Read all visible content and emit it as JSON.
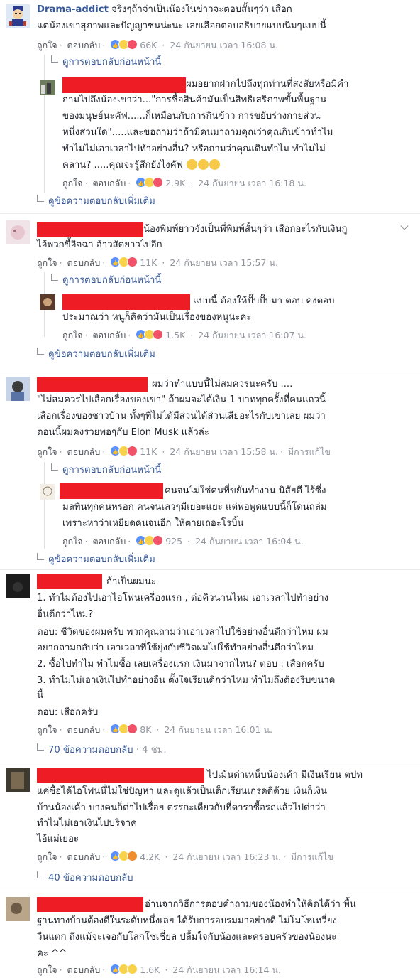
{
  "actions": {
    "like": "ถูกใจ",
    "reply": "ตอบกลับ",
    "edited": "มีการแก้ไข"
  },
  "comments": [
    {
      "author": "Drama-addict",
      "lines": [
        "จริงๆถ้าจ่าเป็นน้องในข่าวจะตอบสั้นๆว่า เสือก",
        "แต่น้องเขาสุภาพและปัญญาชนน่ะนะ เลยเลือกตอบอธิบายแบบนิ่มๆแบบนี้"
      ],
      "reactions": "66K",
      "time": "24 กันยายน เวลา 16:08 น.",
      "prev_replies": "ดูการตอบกลับก่อนหน้านี้"
    },
    {
      "lines": [
        "ผมอยากฝากไปถึงทุกท่านที่สงสัยหรือมีคำ",
        "ถามไปถึงน้องเขาว่า...\"การซื้อสินค้ามันเป็นสิทธิเสรีภาพขั้นพื้นฐาน",
        "ของมนุษย์นะคัฟ......ก็เหมือนกับการกินข้าว การขยับร่างกายส่วน",
        "หนึ่งส่วนใด\".....และขอถามว่าถ้ามีคนมาถามคุณว่าคุณกินข้าวทำไม",
        "ทำไมไม่เอาเวลาไปทำอย่างอื่น? หรือถามว่าคุณเดินทำไม ทำไมไม่",
        "คลาน? .....คุณจะรู้สึกยังไงคัฟ"
      ],
      "reactions": "2.9K",
      "time": "24 กันยายน เวลา 16:18 น.",
      "more_replies": "ดูข้อความตอบกลับเพิ่มเติม"
    },
    {
      "lines": [
        "น้องพิมพ์ยาวจังเป็นพี่พิมพ์สั้นๆว่า เสือกอะไรกับเงินกู",
        "ไอ้พวกขี้อิจฉา อ้าวสัดยาวไปอีก"
      ],
      "reactions": "11K",
      "time": "24 กันยายน เวลา 15:57 น.",
      "prev_replies": "ดูการตอบกลับก่อนหน้านี้"
    },
    {
      "lines": [
        "แบบนี้ ต้องให้ปั๊บปั๊บมา ตอบ คงตอบ",
        "ประมาณว่า หนูก็คิดว่ามันเป็นเรื่องของหนูนะคะ"
      ],
      "reactions": "1.5K",
      "time": "24 กันยายน เวลา 16:07 น.",
      "more_replies": "ดูข้อความตอบกลับเพิ่มเติม"
    },
    {
      "lines": [
        "ผมว่าทำแบบนี้ไม่สมควรนะครับ ....",
        "\"ไม่สมควรไปเสือกเรื่องของเขา\" ถ้าผมจะได้เงิน 1 บาททุกครั้งที่คนแถวนี้",
        "เสือกเรื่องของชาวบ้าน ทั้งๆที่ไม่ได้มีส่วนได้ส่วนเสียอะไรกับเขาเลย ผมว่า",
        "ตอนนี้ผมคงรวยพอๆกับ Elon Musk แล้วล่ะ"
      ],
      "reactions": "11K",
      "time": "24 กันยายน เวลา 15:58 น.",
      "prev_replies": "ดูการตอบกลับก่อนหน้านี้"
    },
    {
      "lines": [
        "คนจนไม่ใช่คนที่ขยันทำงาน นิสัยดี ไร้ซึ่ง",
        "มลทินทุกคนหรอก คนจนเลวๆมีเยอะแยะ แต่พอพูดแบบนี้ก็โดนถล่ม",
        "เพราะหาว่าเหยียดคนจนอีก ให้ตายเถอะโรบิ้น"
      ],
      "reactions": "925",
      "time": "24 กันยายน เวลา 16:04 น.",
      "more_replies": "ดูข้อความตอบกลับเพิ่มเติม"
    },
    {
      "lines": [
        "ถ้าเป็นผมนะ",
        "1. ทำไมต้องไปเอาไอโฟนเครื่องแรก , ต่อคิวนานไหม เอาเวลาไปทำอย่าง",
        "อื่นดีกว่าไหม?",
        "ตอบ: ชีวิตของผมครับ พวกคุณถามว่าเอาเวลาไปใช้อย่างอื่นดีกว่าไหม ผม",
        "อยากถามกลับว่า เอาเวลาที่ใช้ยุ่งกับชีวิตผมไปใช้ทำอย่างอื่นดีกว่าไหม",
        "2. ซื้อไปทำไม ทำไมซื้อ เลยเครื่องแรก เงินมาจากไหน? ตอบ : เสือกครับ",
        "3. ทำไมไม่เอาเงินไปทำอย่างอื่น ตั้งใจเรียนดีกว่าไหม ทำไมถึงต้องรีบขนาด",
        "นี้",
        "ตอบ: เสือกครับ"
      ],
      "reactions": "8K",
      "time": "24 กันยายน เวลา 16:01 น.",
      "reply_count": "70 ข้อความตอบกลับ",
      "reply_age": "4 ชม."
    },
    {
      "lines": [
        "ไปเม้นด่าเหน็บน้องเค้า มีเงินเรียน ตปท",
        "แค่ซื้อได้ไอโฟนนี่ไม่ใช่ปัญหา และดูแล้วเป็นเด็กเรียนเกรดดีด้วย เงินก็เงิน",
        "บ้านน้องเค้า บางคนก็ด่าไปเรื่อย ตรรกะเดียวกับที่ดาราซื้อรถแล้วไปด่าว่า",
        "ทำไมไม่เอาเงินไปบริจาค",
        "ไอ้แม่เยอะ"
      ],
      "reactions": "4.2K",
      "time": "24 กันยายน เวลา 16:23 น.",
      "reply_count": "40 ข้อความตอบกลับ"
    },
    {
      "lines": [
        "อ่านจากวิธีการตอบคำถามของน้องทำให้คิดได้ว่า พื้น",
        "ฐานทางบ้านต้องดีในระดับหนึ่งเลย ได้รับการอบรมมาอย่างดี ไม่โมโหเหวี่ยง",
        "วีนแตก ถึงแม้จะเจอกับโลกโซเชี่ยล ปลื้มใจกับน้องและครอบครัวของน้องนะ",
        "คะ ^^"
      ],
      "reactions": "1.6K",
      "time": "24 กันยายน เวลา 16:14 น."
    }
  ],
  "icons": [
    "like-reaction-icon",
    "haha-reaction-icon",
    "love-reaction-icon",
    "wow-reaction-icon",
    "angry-reaction-icon",
    "reply-arrow-icon",
    "chevron-down-icon"
  ],
  "colors": {
    "link": "#365899",
    "redaction": "#ee1c25",
    "meta": "#90949c"
  }
}
